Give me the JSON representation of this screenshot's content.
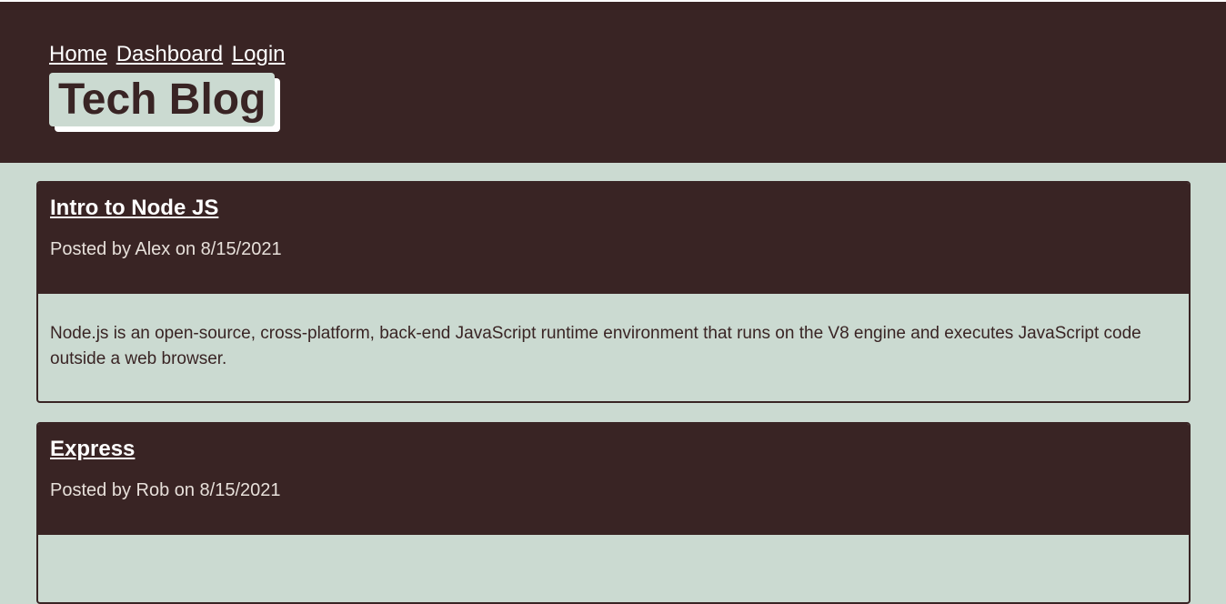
{
  "header": {
    "nav": [
      {
        "label": "Home"
      },
      {
        "label": "Dashboard"
      },
      {
        "label": "Login"
      }
    ],
    "brand_title": "Tech Blog"
  },
  "posts": [
    {
      "title": "Intro to Node JS",
      "meta": "Posted by Alex on 8/15/2021",
      "body": "Node.js is an open-source, cross-platform, back-end JavaScript runtime environment that runs on the V8 engine and executes JavaScript code outside a web browser."
    },
    {
      "title": "Express",
      "meta": "Posted by Rob on 8/15/2021",
      "body": ""
    }
  ],
  "colors": {
    "header_background": "#392424",
    "page_background": "#cbdad1",
    "link_text": "#ffffff"
  }
}
